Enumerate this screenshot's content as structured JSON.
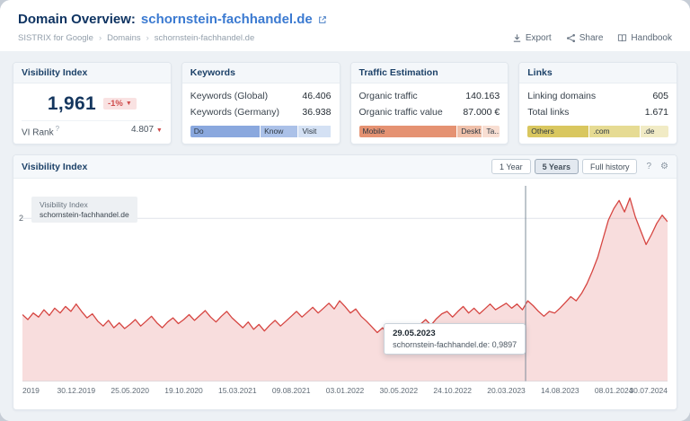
{
  "header": {
    "title_prefix": "Domain Overview:",
    "domain": "schornstein-fachhandel.de",
    "breadcrumb": [
      "SISTRIX for Google",
      "Domains",
      "schornstein-fachhandel.de"
    ],
    "actions": {
      "export": "Export",
      "share": "Share",
      "handbook": "Handbook"
    }
  },
  "icons": {
    "gear": "⚙",
    "help": "?",
    "arrow_down": "▼"
  },
  "cards": {
    "visibility": {
      "title": "Visibility Index",
      "value": "1,961",
      "change": "-1%",
      "vi_rank_label": "VI Rank",
      "vi_rank_value": "4.807"
    },
    "keywords": {
      "title": "Keywords",
      "rows": [
        {
          "label": "Keywords (Global)",
          "value": "46.406"
        },
        {
          "label": "Keywords (Germany)",
          "value": "36.938"
        }
      ],
      "bar": [
        {
          "label": "Do",
          "color": "#8aa8de",
          "pct": 50
        },
        {
          "label": "Know",
          "color": "#abc1e8",
          "pct": 27
        },
        {
          "label": "Visit",
          "color": "#d4e1f4",
          "pct": 23
        }
      ]
    },
    "traffic": {
      "title": "Traffic Estimation",
      "rows": [
        {
          "label": "Organic traffic",
          "value": "140.163"
        },
        {
          "label": "Organic traffic value",
          "value": "87.000 €"
        }
      ],
      "bar": [
        {
          "label": "Mobile",
          "color": "#e59272",
          "pct": 70
        },
        {
          "label": "Deskt...",
          "color": "#efc0aa",
          "pct": 18
        },
        {
          "label": "Ta...",
          "color": "#f8ded2",
          "pct": 12
        }
      ]
    },
    "links": {
      "title": "Links",
      "rows": [
        {
          "label": "Linking domains",
          "value": "605"
        },
        {
          "label": "Total links",
          "value": "1.671"
        }
      ],
      "bar": [
        {
          "label": "Others",
          "color": "#d9c75f",
          "pct": 44
        },
        {
          "label": ".com",
          "color": "#e6db93",
          "pct": 36
        },
        {
          "label": ".de",
          "color": "#f1ebc5",
          "pct": 20
        }
      ]
    }
  },
  "chart": {
    "title": "Visibility Index",
    "ranges": [
      {
        "label": "1 Year"
      },
      {
        "label": "5 Years"
      },
      {
        "label": "Full history"
      }
    ],
    "active_range": "5 Years",
    "legend_title": "Visibility Index",
    "legend_domain": "schornstein-fachhandel.de",
    "tooltip_date": "29.05.2023",
    "tooltip_text": "schornstein-fachhandel.de: 0,9897",
    "y_tick_label": "2"
  },
  "chart_data": {
    "type": "line",
    "title": "Visibility Index",
    "ylabel": "Visibility Index",
    "ylim": [
      0,
      2.4
    ],
    "y_ticks": [
      2
    ],
    "x_tick_labels": [
      "2019",
      "30.12.2019",
      "25.05.2020",
      "19.10.2020",
      "15.03.2021",
      "09.08.2021",
      "03.01.2022",
      "30.05.2022",
      "24.10.2022",
      "20.03.2023",
      "14.08.2023",
      "08.01.2024",
      "30.07.2024"
    ],
    "marker": {
      "date": "29.05.2023",
      "value": 0.9897,
      "x_frac": 0.78
    },
    "series": [
      {
        "name": "schornstein-fachhandel.de",
        "color": "#d64541",
        "fill": "rgba(214,69,65,0.18)",
        "values": [
          0.82,
          0.76,
          0.84,
          0.79,
          0.88,
          0.81,
          0.9,
          0.84,
          0.92,
          0.86,
          0.95,
          0.86,
          0.78,
          0.83,
          0.74,
          0.68,
          0.75,
          0.66,
          0.72,
          0.65,
          0.7,
          0.76,
          0.68,
          0.74,
          0.8,
          0.72,
          0.66,
          0.73,
          0.78,
          0.71,
          0.76,
          0.82,
          0.75,
          0.81,
          0.87,
          0.79,
          0.73,
          0.8,
          0.86,
          0.78,
          0.72,
          0.66,
          0.73,
          0.64,
          0.7,
          0.62,
          0.69,
          0.75,
          0.68,
          0.74,
          0.8,
          0.86,
          0.79,
          0.85,
          0.91,
          0.84,
          0.9,
          0.96,
          0.89,
          0.99,
          0.92,
          0.84,
          0.89,
          0.8,
          0.74,
          0.67,
          0.6,
          0.66,
          0.57,
          0.62,
          0.55,
          0.63,
          0.69,
          0.62,
          0.7,
          0.76,
          0.69,
          0.77,
          0.83,
          0.86,
          0.79,
          0.86,
          0.92,
          0.84,
          0.9,
          0.83,
          0.89,
          0.95,
          0.88,
          0.92,
          0.96,
          0.9,
          0.95,
          0.88,
          0.99,
          0.93,
          0.86,
          0.8,
          0.86,
          0.84,
          0.9,
          0.97,
          1.04,
          0.99,
          1.08,
          1.2,
          1.35,
          1.52,
          1.75,
          1.98,
          2.12,
          2.22,
          2.08,
          2.25,
          2.02,
          1.85,
          1.68,
          1.8,
          1.94,
          2.04,
          1.96
        ]
      }
    ]
  }
}
